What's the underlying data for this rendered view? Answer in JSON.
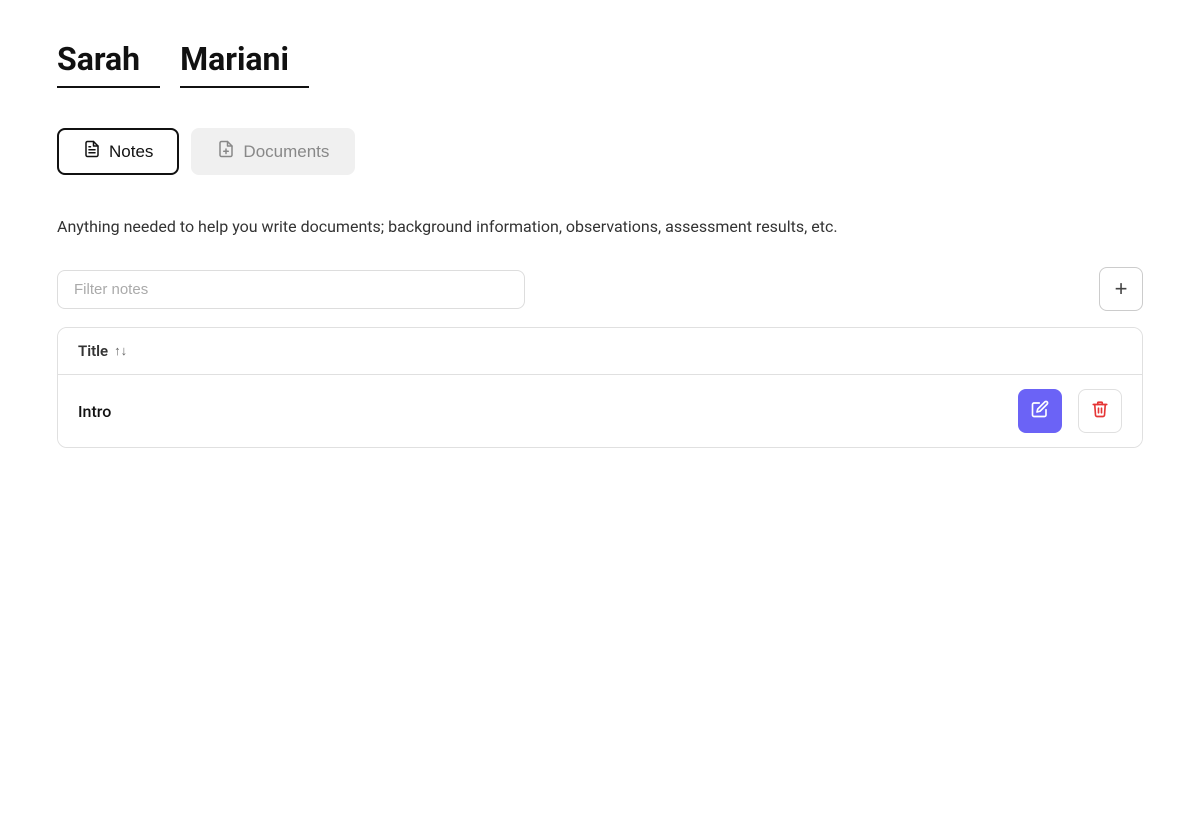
{
  "header": {
    "first_name": "Sarah",
    "last_name": "Mariani"
  },
  "tabs": [
    {
      "id": "notes",
      "label": "Notes",
      "icon": "📄",
      "active": true
    },
    {
      "id": "documents",
      "label": "Documents",
      "icon": "📋",
      "active": false
    }
  ],
  "description": "Anything needed to help you write documents; background information, observations, assessment results, etc.",
  "filter": {
    "placeholder": "Filter notes"
  },
  "table": {
    "column_title": "Title",
    "rows": [
      {
        "id": 1,
        "title": "Intro"
      }
    ]
  },
  "add_button_label": "+",
  "toolbar": {
    "edit_label": "✎",
    "delete_label": "🗑"
  }
}
